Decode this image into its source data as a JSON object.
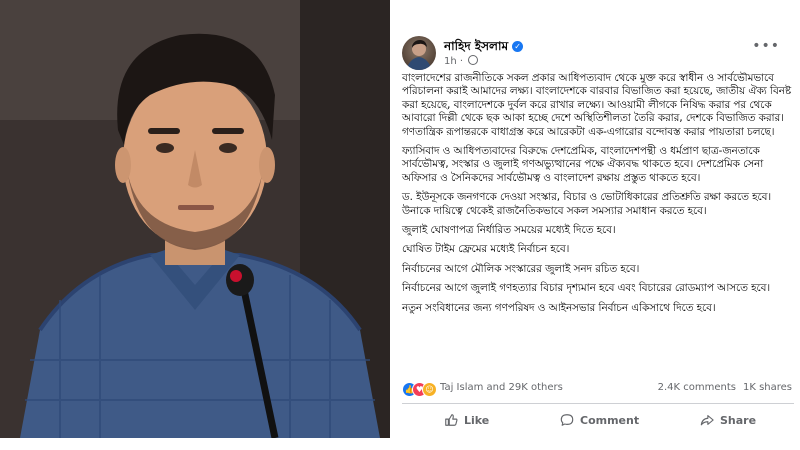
{
  "photo": {
    "alt_subject": "man-speaking-at-microphone"
  },
  "post": {
    "author": "নাহিদ ইসলাম",
    "time": "1h",
    "menu_icon": "more-icon",
    "paragraphs": [
      "বাংলাদেশের রাজনীতিকে সকল প্রকার আধিপত্যবাদ থেকে মুক্ত করে স্বাধীন ও সার্বভৌমভাবে পরিচালনা করাই আমাদের লক্ষ্য। বাংলাদেশকে বারবার বিভাজিত করা হয়েছে, জাতীয় ঐক্য বিনষ্ট করা হয়েছে, বাংলাদেশকে দুর্বল করে রাখার লক্ষ্যে। আওয়ামী লীগকে নিষিদ্ধ করার পর থেকে আবারো দিল্লী থেকে ছক আকা হচ্ছে দেশে অস্থিতিশীলতা তৈরি করার, দেশকে বিভাজিত করার। গণতান্ত্রিক রূপান্তরকে বাধাগ্রস্ত করে আরেকটা এক-এগারোর বন্দোবস্ত করার পায়তারা চলছে।",
      "ফ্যাসিবাদ ও আধিপত্যবাদের বিরুদ্ধে দেশপ্রেমিক, বাংলাদেশপন্থী ও ধর্মপ্রাণ ছাত্র-জনতাকে সার্বভৌমত্ব, সংস্কার ও জুলাই গণঅভ্যুত্থানের পক্ষে ঐক্যবদ্ধ থাকতে হবে। দেশপ্রেমিক সেনা অফিসার ও সৈনিকদের সার্বভৌমত্ব ও বাংলাদেশ রক্ষায় প্রস্তুত থাকতে হবে।",
      "ড. ইউনূসকে জনগণকে দেওয়া সংস্কার, বিচার ও ভোটাধিকারের প্রতিশ্রুতি রক্ষা করতে হবে। উনাকে দায়িত্বে থেকেই রাজনৈতিকভাবে সকল সমস্যার সমাধান করতে হবে।",
      "জুলাই ঘোষণাপত্র নির্ধারিত সময়ের মধ্যেই দিতে হবে।",
      "ঘোষিত টাইম ফ্রেমের মধ্যেই নির্বাচন হবে।",
      "নির্বাচনের আগে মৌলিক সংস্কারের জুলাই সনদ রচিত হবে।",
      "নির্বাচনের আগে জুলাই গণহত্যার বিচার দৃশ্যমান হবে এবং বিচারের রোডম্যাপ আসতে হবে।",
      "নতুন সংবিধানের জন্য গণপরিষদ ও আইনসভার নির্বাচন একিসাথে দিতে হবে।"
    ],
    "reactions_text": "Taj Islam and 29K others",
    "comments_count": "2.4K comments",
    "shares_count": "1K shares",
    "actions": {
      "like": "Like",
      "comment": "Comment",
      "share": "Share"
    }
  },
  "colors": {
    "facebook_blue": "#1877f2",
    "muted_text": "#65676b"
  }
}
